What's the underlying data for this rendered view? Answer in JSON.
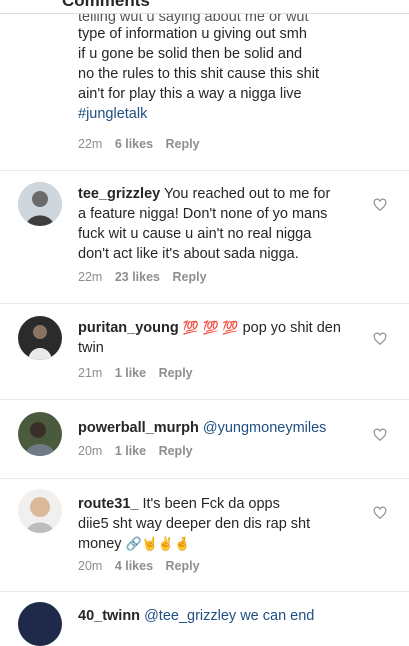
{
  "header": {
    "title": "Comments"
  },
  "comments": [
    {
      "lines": [
        "telling wut u saying about me or wut",
        "type of information u giving out smh",
        "if u gone be solid then be solid and",
        "no the rules to this shit cause this shit",
        "ain't for play this a way a nigga live"
      ],
      "hashtag": "#jungletalk",
      "time": "22m",
      "likes": "6 likes",
      "reply": "Reply"
    },
    {
      "username": "tee_grizzley",
      "first_line": "You reached out to me for",
      "lines": [
        "a feature nigga! Don't none of yo mans",
        "fuck wit u cause u ain't no real nigga",
        "don't act like it's about sada nigga."
      ],
      "time": "22m",
      "likes": "23 likes",
      "reply": "Reply",
      "avatar_icon": "avatar-icon"
    },
    {
      "username": "puritan_young",
      "emoji": "💯 💯 💯",
      "first_line": "pop yo shit den",
      "lines": [
        "twin"
      ],
      "time": "21m",
      "likes": "1 like",
      "reply": "Reply"
    },
    {
      "username": "powerball_murph",
      "mention": "@yungmoneymiles",
      "time": "20m",
      "likes": "1 like",
      "reply": "Reply"
    },
    {
      "username": "route31_",
      "first_line": "It's been Fck da opps",
      "lines": [
        "diie5 sht way deeper den dis rap sht"
      ],
      "last_line": "money",
      "emoji": "🔗🤘✌️🤞",
      "time": "20m",
      "likes": "4 likes",
      "reply": "Reply"
    },
    {
      "username": "40_twinn",
      "mention": "@tee_grizzley we can end"
    }
  ],
  "colors": {
    "text": "#262626",
    "meta": "#8e8e8e",
    "link": "#1f4f82",
    "divider": "#e8e8e8"
  }
}
